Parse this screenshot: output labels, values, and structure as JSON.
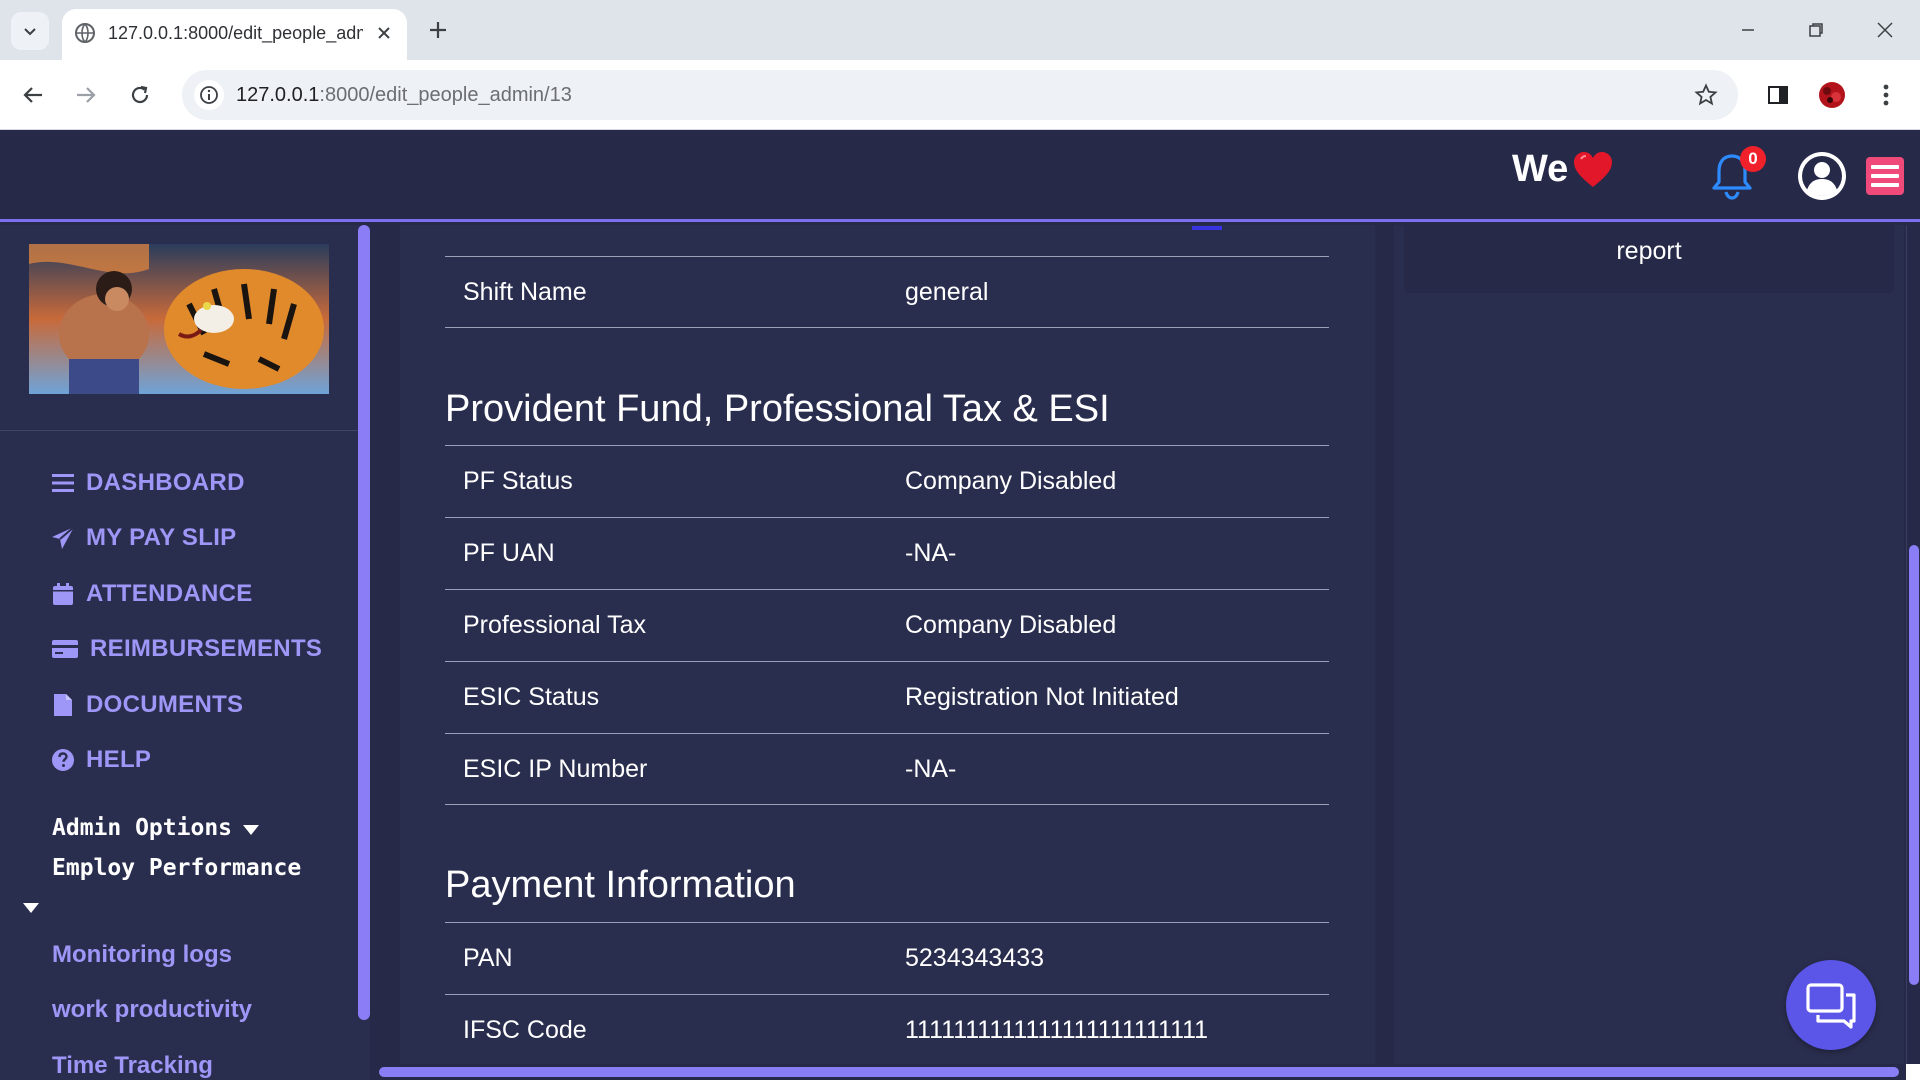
{
  "browser": {
    "tab_title": "127.0.0.1:8000/edit_people_admin/13",
    "url_host": "127.0.0.1",
    "url_rest": ":8000/edit_people_admin/13"
  },
  "header": {
    "brand_text": "We",
    "notification_count": "0"
  },
  "sidebar": {
    "items": [
      {
        "label": "DASHBOARD",
        "icon": "menu-icon"
      },
      {
        "label": "MY PAY SLIP",
        "icon": "paper-plane-icon"
      },
      {
        "label": "ATTENDANCE",
        "icon": "calendar-icon"
      },
      {
        "label": "REIMBURSEMENTS",
        "icon": "credit-card-icon"
      },
      {
        "label": "DOCUMENTS",
        "icon": "document-icon"
      },
      {
        "label": "HELP",
        "icon": "question-circle-icon"
      }
    ],
    "admin_options": "Admin Options",
    "employ_performance": "Employ Performance",
    "sub_items": [
      "Monitoring logs",
      "work productivity",
      "Time Tracking"
    ]
  },
  "main": {
    "shift_row": {
      "label": "Shift Name",
      "value": "general"
    },
    "pf_section": {
      "title": "Provident Fund, Professional Tax & ESI",
      "rows": [
        {
          "label": "PF Status",
          "value": "Company Disabled"
        },
        {
          "label": "PF UAN",
          "value": "-NA-"
        },
        {
          "label": "Professional Tax",
          "value": "Company Disabled"
        },
        {
          "label": "ESIC Status",
          "value": "Registration Not Initiated"
        },
        {
          "label": "ESIC IP Number",
          "value": "-NA-"
        }
      ]
    },
    "payment_section": {
      "title": "Payment Information",
      "rows": [
        {
          "label": "PAN",
          "value": "5234343433"
        },
        {
          "label": "IFSC Code",
          "value": "1111111111111111111111111"
        }
      ]
    }
  },
  "right_panel": {
    "box_text": "report"
  },
  "colors": {
    "background": "#262a48",
    "panel": "#2a2e4e",
    "accent": "#9e97f7",
    "scrollbar": "#8a7df5",
    "header_border": "#7c6ff0",
    "hamburger": "#f04a7a",
    "badge": "#f0212b"
  }
}
